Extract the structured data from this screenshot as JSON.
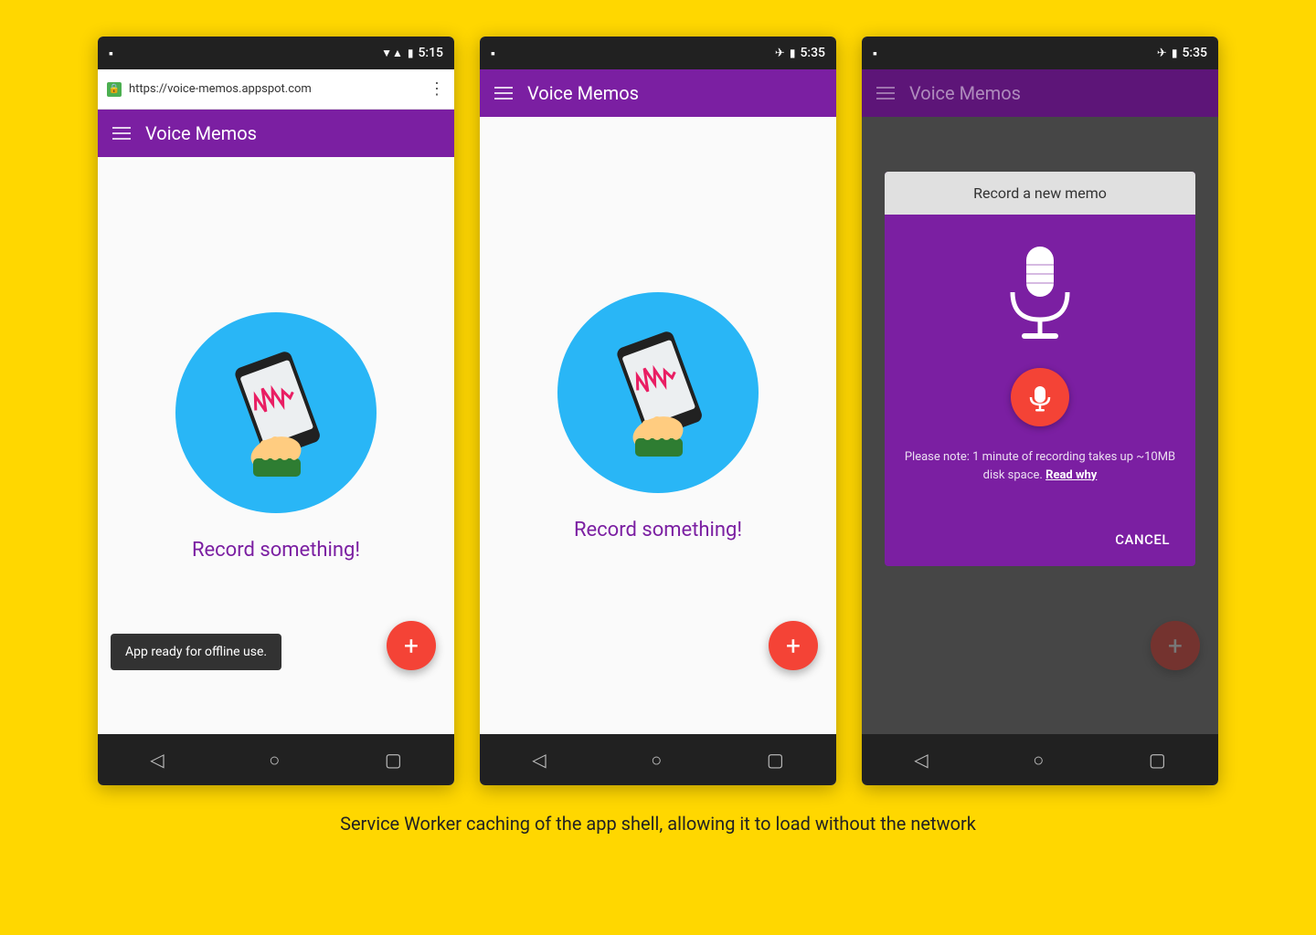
{
  "page": {
    "background": "#FFD700",
    "caption": "Service Worker caching of the app shell, allowing it to load without the network"
  },
  "phone1": {
    "status_bar": {
      "time": "5:15",
      "icons": [
        "wifi",
        "signal",
        "battery"
      ]
    },
    "browser": {
      "url": "https://voice-memos.appspot.com",
      "lock_icon": "🔒"
    },
    "header": {
      "title": "Voice Memos"
    },
    "content": {
      "record_text": "Record something!"
    },
    "fab_label": "+",
    "snackbar_text": "App ready for offline use."
  },
  "phone2": {
    "status_bar": {
      "time": "5:35",
      "icons": [
        "airplane",
        "battery"
      ]
    },
    "header": {
      "title": "Voice Memos"
    },
    "content": {
      "record_text": "Record something!"
    },
    "fab_label": "+"
  },
  "phone3": {
    "status_bar": {
      "time": "5:35",
      "icons": [
        "airplane",
        "battery"
      ]
    },
    "header": {
      "title": "Voice Memos"
    },
    "dialog": {
      "title": "Record a new memo",
      "note_text": "Please note: 1 minute of recording takes up ~10MB disk space.",
      "read_why": "Read why",
      "cancel_label": "CANCEL"
    },
    "fab_label": "+"
  }
}
